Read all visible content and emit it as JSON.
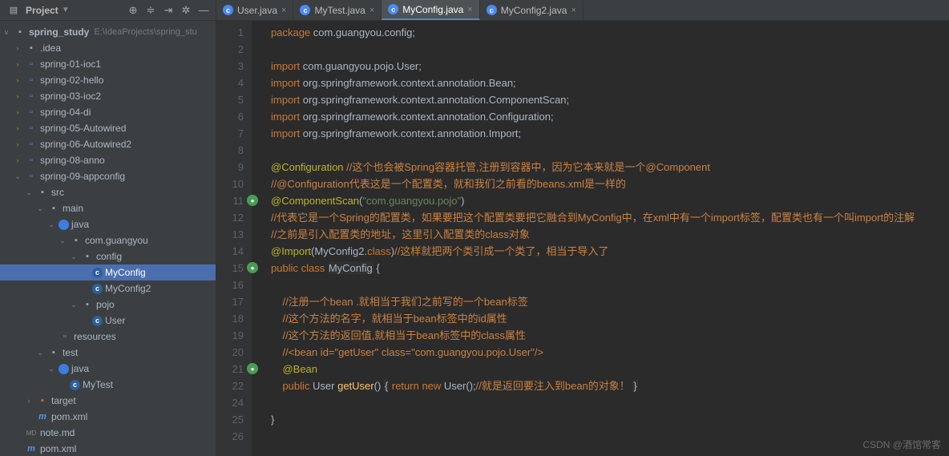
{
  "sidebar": {
    "title": "Project",
    "root": {
      "name": "spring_study",
      "path": "E:\\IdeaProjects\\spring_stu"
    },
    "tree": [
      {
        "ind": 1,
        "arr": ">",
        "icon": "dir",
        "label": ".idea"
      },
      {
        "ind": 1,
        "arr": ">",
        "icon": "mod",
        "label": "spring-01-ioc1"
      },
      {
        "ind": 1,
        "arr": ">",
        "icon": "mod",
        "label": "spring-02-hello"
      },
      {
        "ind": 1,
        "arr": ">",
        "icon": "mod",
        "label": "spring-03-ioc2"
      },
      {
        "ind": 1,
        "arr": ">",
        "icon": "mod",
        "label": "spring-04-di"
      },
      {
        "ind": 1,
        "arr": ">",
        "icon": "mod",
        "label": "spring-05-Autowired"
      },
      {
        "ind": 1,
        "arr": ">",
        "icon": "mod",
        "label": "spring-06-Autowired2"
      },
      {
        "ind": 1,
        "arr": ">",
        "icon": "mod",
        "label": "spring-08-anno"
      },
      {
        "ind": 1,
        "arr": "v",
        "icon": "mod",
        "label": "spring-09-appconfig"
      },
      {
        "ind": 2,
        "arr": "v",
        "icon": "dir",
        "label": "src"
      },
      {
        "ind": 3,
        "arr": "v",
        "icon": "dir",
        "label": "main"
      },
      {
        "ind": 4,
        "arr": "v",
        "icon": "jav",
        "label": "java"
      },
      {
        "ind": 5,
        "arr": "v",
        "icon": "dir",
        "label": "com.guangyou"
      },
      {
        "ind": 6,
        "arr": "v",
        "icon": "dir",
        "label": "config"
      },
      {
        "ind": 7,
        "arr": "",
        "icon": "cls",
        "label": "MyConfig",
        "sel": true
      },
      {
        "ind": 7,
        "arr": "",
        "icon": "cls",
        "label": "MyConfig2"
      },
      {
        "ind": 6,
        "arr": "v",
        "icon": "dir",
        "label": "pojo"
      },
      {
        "ind": 7,
        "arr": "",
        "icon": "cls",
        "label": "User"
      },
      {
        "ind": 4,
        "arr": "",
        "icon": "res",
        "label": "resources"
      },
      {
        "ind": 3,
        "arr": "v",
        "icon": "dir",
        "label": "test"
      },
      {
        "ind": 4,
        "arr": "v",
        "icon": "jav",
        "label": "java"
      },
      {
        "ind": 5,
        "arr": "",
        "icon": "cls",
        "label": "MyTest"
      },
      {
        "ind": 2,
        "arr": ">",
        "icon": "tgt",
        "label": "target"
      },
      {
        "ind": 2,
        "arr": "",
        "icon": "pom",
        "label": "pom.xml"
      },
      {
        "ind": 1,
        "arr": "",
        "icon": "md",
        "label": "note.md"
      },
      {
        "ind": 1,
        "arr": "",
        "icon": "pom",
        "label": "pom.xml"
      }
    ]
  },
  "tabs": [
    {
      "label": "User.java",
      "active": false
    },
    {
      "label": "MyTest.java",
      "active": false
    },
    {
      "label": "MyConfig.java",
      "active": true
    },
    {
      "label": "MyConfig2.java",
      "active": false
    }
  ],
  "code": {
    "lines": [
      {
        "n": 1,
        "seg": [
          {
            "t": "package ",
            "c": "kw"
          },
          {
            "t": "com.guangyou.config;",
            "c": "pkg"
          }
        ]
      },
      {
        "n": 2,
        "seg": []
      },
      {
        "n": 3,
        "seg": [
          {
            "t": "import ",
            "c": "kw"
          },
          {
            "t": "com.guangyou.pojo.User;",
            "c": "pkg"
          }
        ]
      },
      {
        "n": 4,
        "seg": [
          {
            "t": "import ",
            "c": "kw"
          },
          {
            "t": "org.springframework.context.annotation.Bean;",
            "c": "pkg"
          }
        ]
      },
      {
        "n": 5,
        "seg": [
          {
            "t": "import ",
            "c": "kw"
          },
          {
            "t": "org.springframework.context.annotation.ComponentScan;",
            "c": "pkg"
          }
        ]
      },
      {
        "n": 6,
        "seg": [
          {
            "t": "import ",
            "c": "kw"
          },
          {
            "t": "org.springframework.context.annotation.Configuration;",
            "c": "pkg"
          }
        ]
      },
      {
        "n": 7,
        "seg": [
          {
            "t": "import ",
            "c": "kw"
          },
          {
            "t": "org.springframework.context.annotation.Import;",
            "c": "pkg"
          }
        ]
      },
      {
        "n": 8,
        "seg": []
      },
      {
        "n": 9,
        "seg": [
          {
            "t": "@Configuration ",
            "c": "ann"
          },
          {
            "t": "//这个也会被Spring容器托管,注册到容器中，因为它本来就是一个@Component",
            "c": "cmt-o"
          }
        ]
      },
      {
        "n": 10,
        "seg": [
          {
            "t": "//@Configuration代表这是一个配置类，就和我们之前看的beans.xml是一样的",
            "c": "cmt-o"
          }
        ]
      },
      {
        "n": 11,
        "g": "b",
        "seg": [
          {
            "t": "@ComponentScan",
            "c": "ann"
          },
          {
            "t": "(",
            "c": "pkg"
          },
          {
            "t": "\"com.guangyou.pojo\"",
            "c": "str"
          },
          {
            "t": ")",
            "c": "pkg"
          }
        ]
      },
      {
        "n": 12,
        "seg": [
          {
            "t": "//代表它是一个Spring的配置类，如果要把这个配置类要把它融合到MyConfig中，在xml中有一个import标签，配置类也有一个叫import的注解",
            "c": "cmt-o"
          }
        ]
      },
      {
        "n": 13,
        "seg": [
          {
            "t": "//之前是引入配置类的地址，这里引入配置类的class对象",
            "c": "cmt-o"
          }
        ]
      },
      {
        "n": 14,
        "seg": [
          {
            "t": "@Import",
            "c": "ann"
          },
          {
            "t": "(MyConfig2.",
            "c": "pkg"
          },
          {
            "t": "class",
            "c": "kw"
          },
          {
            "t": ")",
            "c": "pkg"
          },
          {
            "t": "//这样就把两个类引成一个类了，相当于导入了",
            "c": "cmt-o"
          }
        ]
      },
      {
        "n": 15,
        "g": "b",
        "seg": [
          {
            "t": "public class ",
            "c": "kw"
          },
          {
            "t": "MyConfig",
            "c": "cls-n hlb"
          },
          {
            "t": " {",
            "c": "pkg"
          }
        ]
      },
      {
        "n": 16,
        "seg": []
      },
      {
        "n": 17,
        "seg": [
          {
            "t": "    ",
            "c": ""
          },
          {
            "t": "//注册一个bean .就相当于我们之前写的一个bean标签",
            "c": "cmt-o"
          }
        ]
      },
      {
        "n": 18,
        "seg": [
          {
            "t": "    ",
            "c": ""
          },
          {
            "t": "//这个方法的名字，就相当于bean标签中的id属性",
            "c": "cmt-o"
          }
        ]
      },
      {
        "n": 19,
        "seg": [
          {
            "t": "    ",
            "c": ""
          },
          {
            "t": "//这个方法的返回值,就相当于bean标签中的class属性",
            "c": "cmt-o"
          }
        ]
      },
      {
        "n": 20,
        "seg": [
          {
            "t": "    ",
            "c": ""
          },
          {
            "t": "//<bean id=\"getUser\" class=\"com.guangyou.pojo.User\"/>",
            "c": "cmt-o"
          }
        ]
      },
      {
        "n": 21,
        "g": "b",
        "seg": [
          {
            "t": "    ",
            "c": ""
          },
          {
            "t": "@Bean",
            "c": "ann"
          }
        ]
      },
      {
        "n": 22,
        "seg": [
          {
            "t": "    ",
            "c": ""
          },
          {
            "t": "public ",
            "c": "kw"
          },
          {
            "t": "User ",
            "c": "pkg"
          },
          {
            "t": "getUser",
            "c": "fn"
          },
          {
            "t": "() ",
            "c": "pkg"
          },
          {
            "t": "{",
            "c": "pkg hlb"
          },
          {
            "t": " ",
            "c": ""
          },
          {
            "t": "return new ",
            "c": "kw"
          },
          {
            "t": "User();",
            "c": "pkg"
          },
          {
            "t": "//就是返回要注入到bean的对象！ ",
            "c": "cmt-o"
          },
          {
            "t": "}",
            "c": "pkg hlb"
          }
        ]
      },
      {
        "n": 24,
        "seg": []
      },
      {
        "n": 25,
        "seg": [
          {
            "t": "}",
            "c": "pkg"
          }
        ]
      },
      {
        "n": 26,
        "seg": []
      }
    ]
  },
  "watermark": "CSDN @酒馆常客"
}
